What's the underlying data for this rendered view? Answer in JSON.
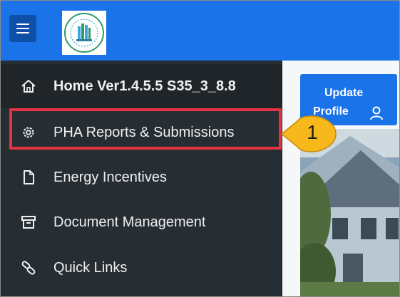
{
  "header": {
    "menu_icon": "hamburger-menu-icon",
    "logo_alt": "Department of Housing and Urban Development seal"
  },
  "sidebar": {
    "items": [
      {
        "label": "Home Ver1.4.5.5 S35_3_8.8",
        "icon": "home-icon"
      },
      {
        "label": "PHA Reports & Submissions",
        "icon": "gear-icon"
      },
      {
        "label": "Energy Incentives",
        "icon": "document-icon"
      },
      {
        "label": "Document Management",
        "icon": "archive-box-icon"
      },
      {
        "label": "Quick Links",
        "icon": "link-icon"
      }
    ]
  },
  "main": {
    "update_profile_line1": "Update",
    "update_profile_line2": "Profile",
    "update_profile_icon": "user-icon"
  },
  "annotation": {
    "callout_number": "1",
    "callout_color": "#f6b81a",
    "highlight_color": "#e5343f"
  },
  "colors": {
    "topbar": "#1a73e8",
    "sidebar": "#262d33"
  }
}
